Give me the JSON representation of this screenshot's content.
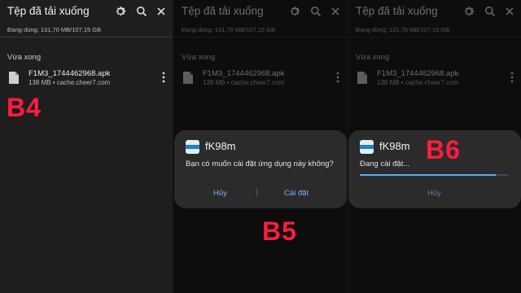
{
  "colors": {
    "background": "#1e1e1e",
    "accent": "#7fb2ff",
    "step_label": "#ff1d3e",
    "progress": "#5ea6f5"
  },
  "downloads": {
    "title": "Tệp đã tải xuống",
    "storage": "Đang dùng: 131,70 MB/107,15 GB",
    "section": "Vừa xong",
    "icons": [
      "gear-icon",
      "search-icon",
      "close-icon"
    ],
    "file": {
      "name": "F1M3_1744462968.apk",
      "meta": "138 MB • cache.cheer7.com"
    }
  },
  "install_prompt": {
    "app_name": "fK98m",
    "question": "Bạn có muốn cài đặt ứng dụng này không?",
    "cancel": "Hủy",
    "install": "Cài đặt"
  },
  "installing": {
    "app_name": "fK98m",
    "status": "Đang cài đặt...",
    "progress": 0.92,
    "cancel": "Hủy"
  },
  "steps": {
    "b4": "B4",
    "b5": "B5",
    "b6": "B6"
  }
}
